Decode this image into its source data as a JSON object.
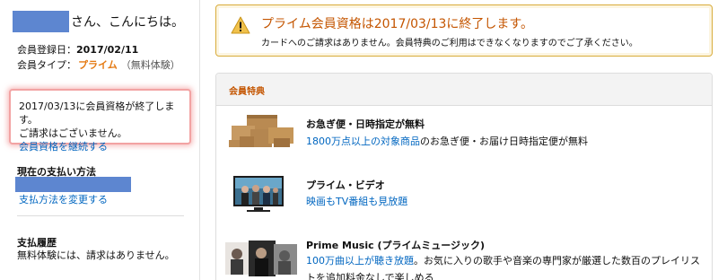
{
  "greeting": "さん、こんにちは。",
  "registration": {
    "label": "会員登録日：",
    "date": "2017/02/11"
  },
  "membership": {
    "label": "会員タイプ：",
    "type": "プライム",
    "trial": "（無料体験）"
  },
  "notice": {
    "line1": "2017/03/13に会員資格が終了します。",
    "line2": "ご請求はございません。",
    "link": "会員資格を継続する"
  },
  "payment": {
    "title": "現在の支払い方法",
    "change_link": "支払方法を変更する"
  },
  "history": {
    "title": "支払履歴",
    "text": "無料体験には、請求はありません。"
  },
  "alert": {
    "title": "プライム会員資格は2017/03/13に終了します。",
    "text": "カードへのご請求はありません。会員特典のご利用はできなくなりますのでご了承ください。"
  },
  "benefits": {
    "header": "会員特典",
    "items": [
      {
        "title": "お急ぎ便・日時指定が無料",
        "link": "1800万点以上の対象商品",
        "desc": "のお急ぎ便・お届け日時指定便が無料"
      },
      {
        "title": "プライム・ビデオ",
        "link": "映画もTV番組も見放題",
        "desc": ""
      },
      {
        "title": "Prime Music (プライムミュージック)",
        "link": "100万曲以上が聴き放題",
        "desc": "。お気に入りの歌手や音楽の専門家が厳選した数百のプレイリストを追加料金なしで楽しめる"
      }
    ]
  },
  "colors": {
    "accent": "#c45500",
    "link": "#0066c0",
    "prime": "#e47911",
    "alert_border": "#d8ac3a"
  }
}
